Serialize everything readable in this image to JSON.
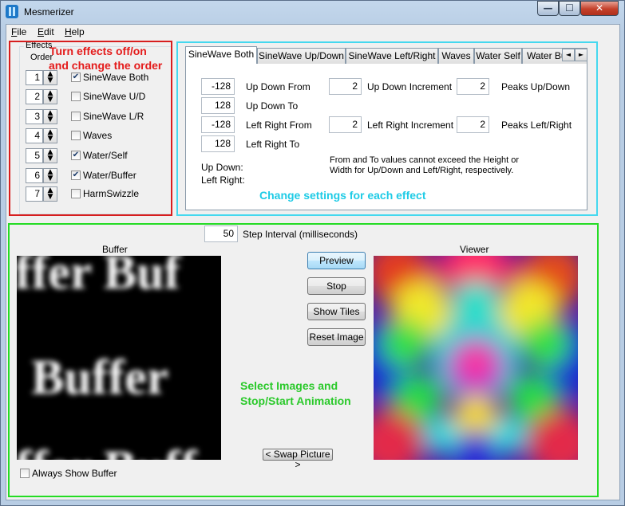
{
  "window": {
    "title": "Mesmerizer"
  },
  "caption_buttons": {
    "minimize": "—",
    "maximize": "☐",
    "close": "✕"
  },
  "menu": [
    {
      "label": "File",
      "accel": "F",
      "rest": "ile"
    },
    {
      "label": "Edit",
      "accel": "E",
      "rest": "dit"
    },
    {
      "label": "Help",
      "accel": "H",
      "rest": "elp"
    }
  ],
  "effects": {
    "group_title": "Effects",
    "order_label": "Order",
    "items": [
      {
        "order": "1",
        "label": "SineWave Both",
        "checked": true
      },
      {
        "order": "2",
        "label": "SineWave U/D",
        "checked": false
      },
      {
        "order": "3",
        "label": "SineWave L/R",
        "checked": false
      },
      {
        "order": "4",
        "label": "Waves",
        "checked": false
      },
      {
        "order": "5",
        "label": "Water/Self",
        "checked": true
      },
      {
        "order": "6",
        "label": "Water/Buffer",
        "checked": true
      },
      {
        "order": "7",
        "label": "HarmSwizzle",
        "checked": false
      }
    ]
  },
  "annotations": {
    "red": [
      "Turn effects off/on",
      "and change the order"
    ],
    "cyan": "Change settings for each effect",
    "green": [
      "Select Images and",
      "Stop/Start Animation"
    ]
  },
  "tabs": [
    "SineWave Both",
    "SineWave Up/Down",
    "SineWave Left/Right",
    "Waves",
    "Water Self",
    "Water Bu"
  ],
  "tab_scroll": {
    "left": "◄",
    "right": "►"
  },
  "sinewave": {
    "ud_from": {
      "value": "-128",
      "label": "Up Down From"
    },
    "ud_to": {
      "value": "128",
      "label": "Up Down To"
    },
    "lr_from": {
      "value": "-128",
      "label": "Left Right From"
    },
    "lr_to": {
      "value": "128",
      "label": "Left Right To"
    },
    "ud_increment": {
      "value": "2",
      "label": "Up Down Increment"
    },
    "lr_increment": {
      "value": "2",
      "label": "Left Right Increment"
    },
    "peaks_ud": {
      "value": "2",
      "label": "Peaks Up/Down"
    },
    "peaks_lr": {
      "value": "2",
      "label": "Peaks Left/Right"
    },
    "status_ud": "Up Down:",
    "status_lr": "Left Right:",
    "note_line1": "From and To values cannot exceed the Height or",
    "note_line2": "Width for Up/Down and Left/Right, respectively."
  },
  "animation": {
    "step_value": "50",
    "step_label": "Step Interval (milliseconds)",
    "buffer_label": "Buffer",
    "viewer_label": "Viewer",
    "buffer_text": [
      "ffer Buf",
      "Buffer",
      "ffer Buff"
    ],
    "buttons": {
      "preview": "Preview",
      "stop": "Stop",
      "show_tiles": "Show Tiles",
      "reset_image": "Reset Image"
    },
    "swap_picture": "< Swap Picture >",
    "always_show_buffer": {
      "label": "Always Show Buffer",
      "checked": false
    }
  }
}
